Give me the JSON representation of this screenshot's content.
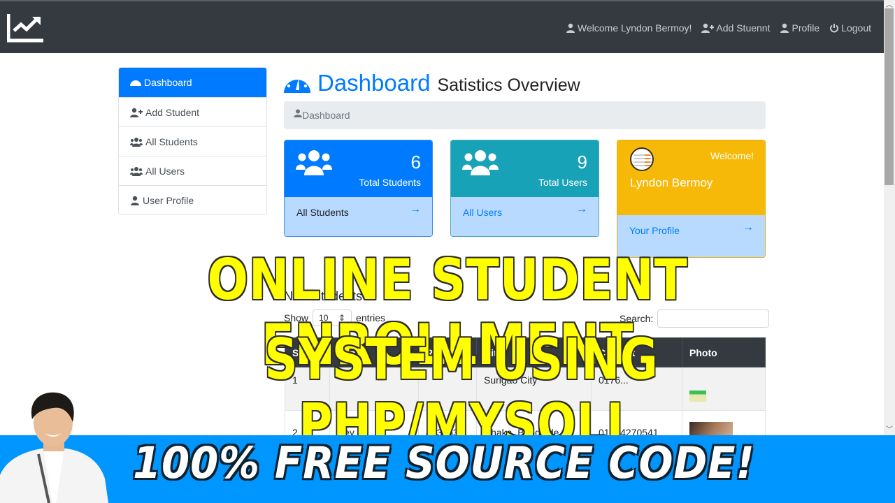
{
  "navbar": {
    "brand_icon": "chart-line-icon",
    "links": [
      {
        "icon": "user-icon",
        "label": "Welcome Lyndon Bermoy!"
      },
      {
        "icon": "user-plus-icon",
        "label": "Add Stuennt"
      },
      {
        "icon": "user-icon",
        "label": "Profile"
      },
      {
        "icon": "power-icon",
        "label": "Logout"
      }
    ]
  },
  "sidebar": {
    "items": [
      {
        "icon": "dashboard-gauge-icon",
        "label": "Dashboard",
        "active": true
      },
      {
        "icon": "user-plus-icon",
        "label": "Add Student"
      },
      {
        "icon": "users-icon",
        "label": "All Students"
      },
      {
        "icon": "users-icon",
        "label": "All Users"
      },
      {
        "icon": "user-icon",
        "label": "User Profile"
      }
    ]
  },
  "header": {
    "title": "Dashboard",
    "subtitle": "Satistics Overview",
    "breadcrumb": "Dashboard"
  },
  "cards": {
    "students": {
      "count": "6",
      "caption": "Total Students",
      "link": "All Students",
      "arrow": "→",
      "color": "#007bff"
    },
    "users": {
      "count": "9",
      "caption": "Total Users",
      "link": "All Users",
      "arrow": "→",
      "color": "#17a2b8"
    },
    "profile": {
      "welcome": "Welcome!",
      "name": "Lyndon Bermoy",
      "link": "Your Profile",
      "arrow": "→",
      "color": "#ffc107"
    }
  },
  "datatable": {
    "section_title": "New Students",
    "show_label": "Show",
    "entries_label": "entries",
    "page_length": "10",
    "search_label": "Search:",
    "search_value": "",
    "columns": [
      "SL",
      "Name",
      "Roll",
      "City",
      "Contact",
      "Photo"
    ],
    "rows": [
      {
        "sl": "1",
        "name": "",
        "roll": "",
        "city": "Surigao City",
        "contact": "0176..."
      },
      {
        "sl": "2",
        "name": "Hey",
        "roll": "443353",
        "city": "Dhaka, Banglade",
        "contact": "01814270541"
      }
    ]
  },
  "overlay": {
    "headline_line1": "ONLINE STUDENT ENROLLMENT",
    "headline_line2": "SYSTEM USING PHP/MYSQLI",
    "footer": "100% FREE SOURCE CODE!"
  }
}
